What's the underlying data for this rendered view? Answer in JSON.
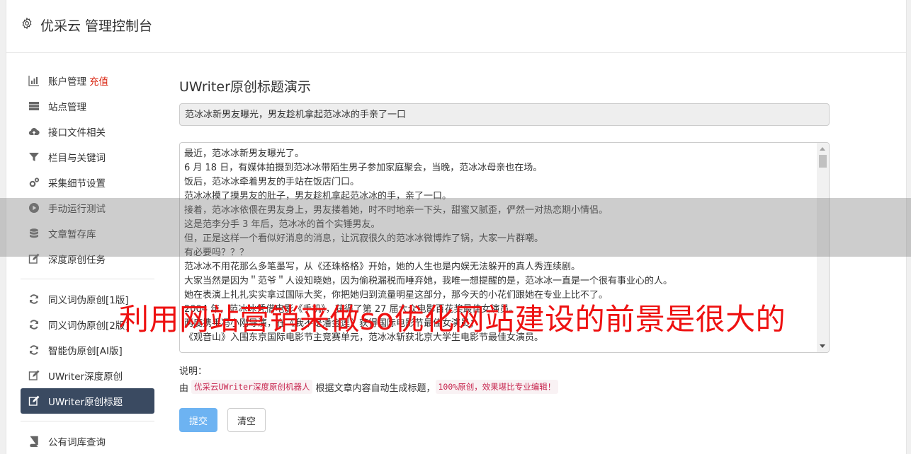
{
  "header": {
    "brand": "优采云 管理控制台"
  },
  "sidebar": {
    "group1": [
      {
        "label": "账户管理",
        "badge": "充值",
        "icon": "bar-chart-icon"
      },
      {
        "label": "站点管理",
        "icon": "server-icon"
      },
      {
        "label": "接口文件相关",
        "icon": "cloud-upload-icon"
      },
      {
        "label": "栏目与关键词",
        "icon": "filter-icon"
      },
      {
        "label": "采集细节设置",
        "icon": "cogs-icon"
      },
      {
        "label": "手动运行测试",
        "icon": "play-icon"
      },
      {
        "label": "文章暂存库",
        "icon": "database-icon"
      },
      {
        "label": "深度原创任务",
        "icon": "edit-icon"
      }
    ],
    "group2": [
      {
        "label": "同义词伪原创[1版]",
        "icon": "refresh-icon"
      },
      {
        "label": "同义词伪原创[2版]",
        "icon": "refresh-icon"
      },
      {
        "label": "智能伪原创[AI版]",
        "icon": "refresh-icon"
      },
      {
        "label": "UWriter深度原创",
        "icon": "edit-icon"
      },
      {
        "label": "UWriter原创标题",
        "icon": "edit-icon",
        "active": true
      }
    ],
    "group3": [
      {
        "label": "公有词库查询",
        "icon": "book-icon"
      }
    ]
  },
  "main": {
    "heading": "UWriter原创标题演示",
    "title_value": "范冰冰新男友曝光，男友趁机拿起范冰冰的手亲了一口",
    "content_lines": [
      "最近，范冰冰新男友曝光了。",
      "6 月 18 日，有媒体拍摄到范冰冰带陌生男子参加家庭聚会，当晚，范冰冰母亲也在场。",
      "饭后，范冰冰牵着男友的手站在饭店门口。",
      "范冰冰摸了摸男友的肚子，男友趁机拿起范冰冰的手，亲了一口。",
      "接着，范冰冰依偎在男友身上，男友搂着她，时不时地亲一下头，甜蜜又腻歪，俨然一对热恋期小情侣。",
      "这是范李分手 3 年后，范冰冰的首个实锤男友。",
      "但，正是这样一个看似好消息的消息，让沉寂很久的范冰冰微博炸了锅，大家一片群嘲。",
      "有必要吗？？？",
      "范冰冰不用花那么多笔墨写，从《还珠格格》开始，她的人生也是内娱无法躲开的真人秀连续剧。",
      "大家当然是因为＂范爷＂人设知晓她，因为偷税漏税而唾弃她，我唯一想提醒的是，范冰冰一直是一个很有事业心的人。",
      "她在表演上扎扎实实拿过国际大奖，你把她归到流量明星这部分，那今天的小花们跟她在专业上比不了。",
      "2004 年，范冰冰凭借电影《手机》，获得了第 27 届大众电影百花奖最佳女演员。",
      "两度携手冯小刚导演，在《我不是潘金莲》获得国际电影节最佳女演员；",
      "《观音山》入围东京国际电影节主竞赛单元，范冰冰斩获北京大学生电影节最佳女演员。"
    ],
    "note_label": "说明：",
    "note_prefix": "由",
    "note_code1": "优采云UWriter深度原创机器人",
    "note_mid": "根据文章内容自动生成标题，",
    "note_code2": "100%原创，效果堪比专业编辑！",
    "submit_label": "提交",
    "clear_label": "清空"
  },
  "overlay": {
    "text": "利用网站营销来做so优化网站建设的前景是很大的"
  },
  "colors": {
    "active_bg": "#3a4a61",
    "submit_bg": "#6db3f2",
    "overlay_text": "#ee1111"
  }
}
